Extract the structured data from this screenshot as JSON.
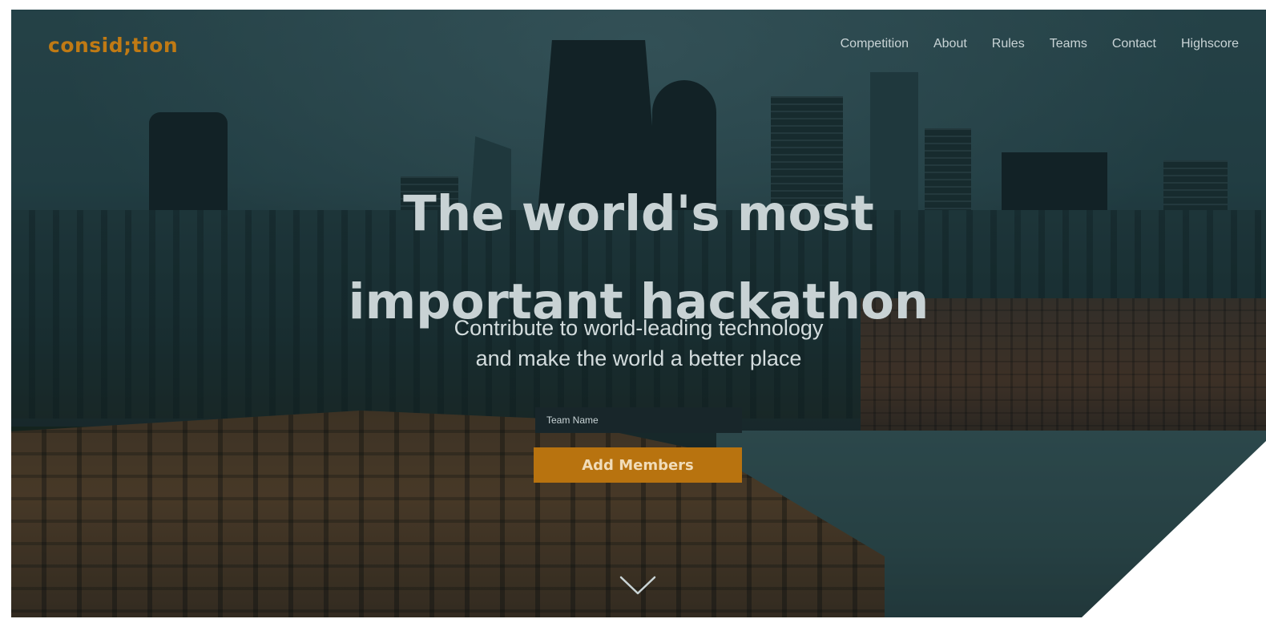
{
  "header": {
    "logo": "consid;tion",
    "nav": [
      {
        "label": "Competition"
      },
      {
        "label": "About"
      },
      {
        "label": "Rules"
      },
      {
        "label": "Teams"
      },
      {
        "label": "Contact"
      },
      {
        "label": "Highscore"
      }
    ]
  },
  "hero": {
    "title_line1": "The world's most",
    "title_line2": "important hackathon",
    "subtitle_line1": "Contribute to world-leading technology",
    "subtitle_line2": "and make the world a better place"
  },
  "form": {
    "team_name_placeholder": "Team Name",
    "add_members_label": "Add Members"
  },
  "icons": {
    "scroll": "chevron-down-icon"
  },
  "colors": {
    "accent": "#b8730f",
    "logo": "#c07a14",
    "nav_text": "#c9d4d6"
  }
}
